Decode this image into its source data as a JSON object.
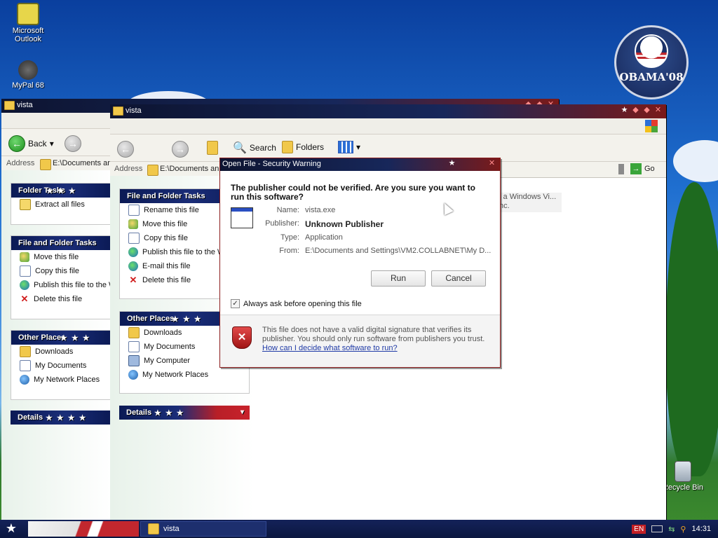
{
  "desktop": {
    "icons": [
      {
        "label": "Microsoft Outlook",
        "icon": "outlook-icon"
      },
      {
        "label": "MyPal 68",
        "icon": "raccoon-icon"
      },
      {
        "label": "Recycle Bin",
        "icon": "recycle-bin-icon"
      }
    ],
    "badge": {
      "text": "OBAMA'08"
    }
  },
  "back_window": {
    "title": "vista",
    "toolbar": {
      "back_label": "Back"
    },
    "address": {
      "label": "Address",
      "value": "E:\\Documents an"
    },
    "panels": {
      "folder_tasks": {
        "title": "Folder Tasks",
        "items": [
          "Extract all files"
        ]
      },
      "file_folder_tasks": {
        "title": "File and Folder Tasks",
        "items": [
          "Move this file",
          "Copy this file",
          "Publish this file to the W",
          "Delete this file"
        ]
      },
      "other_places": {
        "title": "Other Places",
        "items": [
          "Downloads",
          "My Documents",
          "My Network Places"
        ]
      },
      "details": {
        "title": "Details"
      }
    }
  },
  "front_window": {
    "title": "vista",
    "toolbar": {
      "search_label": "Search",
      "folders_label": "Folders"
    },
    "address": {
      "label": "Address",
      "value": "E:\\Documents an",
      "go_label": "Go"
    },
    "file_info": {
      "line1": "s a Windows Vi...",
      "line2": "Inc."
    },
    "panels": {
      "file_folder_tasks": {
        "title": "File and Folder Tasks",
        "items": [
          "Rename this file",
          "Move this file",
          "Copy this file",
          "Publish this file to the W",
          "E-mail this file",
          "Delete this file"
        ]
      },
      "other_places": {
        "title": "Other Places",
        "items": [
          "Downloads",
          "My Documents",
          "My Computer",
          "My Network Places"
        ]
      },
      "details": {
        "title": "Details"
      }
    }
  },
  "dialog": {
    "title": "Open File - Security Warning",
    "question": "The publisher could not be verified.  Are you sure you want to run this software?",
    "fields": {
      "name_label": "Name:",
      "name_value": "vista.exe",
      "publisher_label": "Publisher:",
      "publisher_value": "Unknown Publisher",
      "type_label": "Type:",
      "type_value": "Application",
      "from_label": "From:",
      "from_value": "E:\\Documents and Settings\\VM2.COLLABNET\\My D..."
    },
    "run_label": "Run",
    "cancel_label": "Cancel",
    "always_ask_label": "Always ask before opening this file",
    "always_ask_checked": true,
    "footer_text": "This file does not have a valid digital signature that verifies its publisher.  You should only run software from publishers you trust.",
    "footer_link": "How can I decide what software to run?"
  },
  "taskbar": {
    "task_label": "vista",
    "language": "EN",
    "clock": "14:31"
  }
}
